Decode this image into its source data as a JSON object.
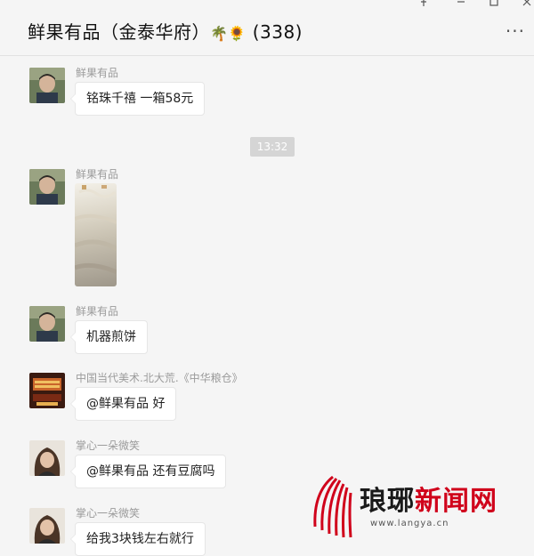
{
  "header": {
    "title": "鲜果有品（金泰华府）",
    "emoji": "🌴🌻",
    "member_count": "(338)",
    "pin_icon": "pin-icon",
    "more_label": "···"
  },
  "colors": {
    "background": "#f5f5f5",
    "bubble": "#ffffff",
    "timestamp_bg": "#d5d5d5",
    "sender_text": "#9b9b9b",
    "watermark_red": "#d0021b",
    "watermark_dark": "#1a1a1a"
  },
  "messages": [
    {
      "sender": "鲜果有品",
      "text": "铭珠千禧 一箱58元"
    },
    {
      "sender": "鲜果有品"
    },
    {
      "sender": "鲜果有品",
      "text": "机器煎饼"
    },
    {
      "sender": "中国当代美术.北大荒.《中华粮仓》",
      "text": "@鲜果有品 好"
    },
    {
      "sender": "掌心一朵微笑",
      "text": "@鲜果有品 还有豆腐吗"
    },
    {
      "sender": "掌心一朵微笑",
      "text": "给我3块钱左右就行"
    }
  ],
  "timestamp": "13:32",
  "watermark": {
    "part1": "琅琊",
    "part2": "新闻网",
    "url": "www.langya.cn"
  }
}
